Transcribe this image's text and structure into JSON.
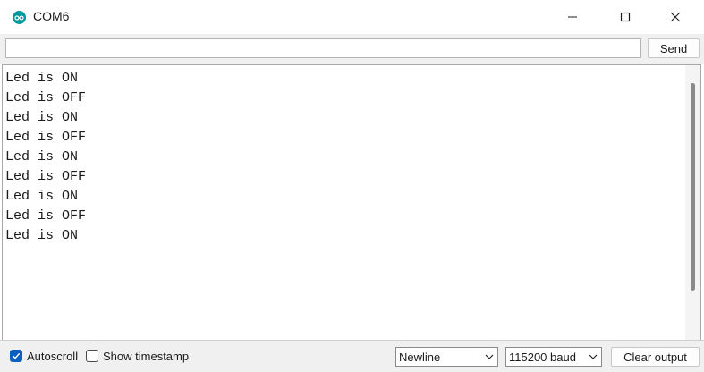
{
  "window": {
    "title": "COM6"
  },
  "input": {
    "value": "",
    "send_label": "Send"
  },
  "output": {
    "lines": [
      "Led is ON",
      "Led is OFF",
      "Led is ON",
      "Led is OFF",
      "Led is ON",
      "Led is OFF",
      "Led is ON",
      "Led is OFF",
      "Led is ON"
    ]
  },
  "status": {
    "autoscroll_label": "Autoscroll",
    "autoscroll_checked": true,
    "timestamp_label": "Show timestamp",
    "timestamp_checked": false,
    "line_ending": "Newline",
    "baud_rate": "115200 baud",
    "clear_label": "Clear output"
  },
  "colors": {
    "accent": "#0a5fc0",
    "app_icon": "#00979c"
  }
}
